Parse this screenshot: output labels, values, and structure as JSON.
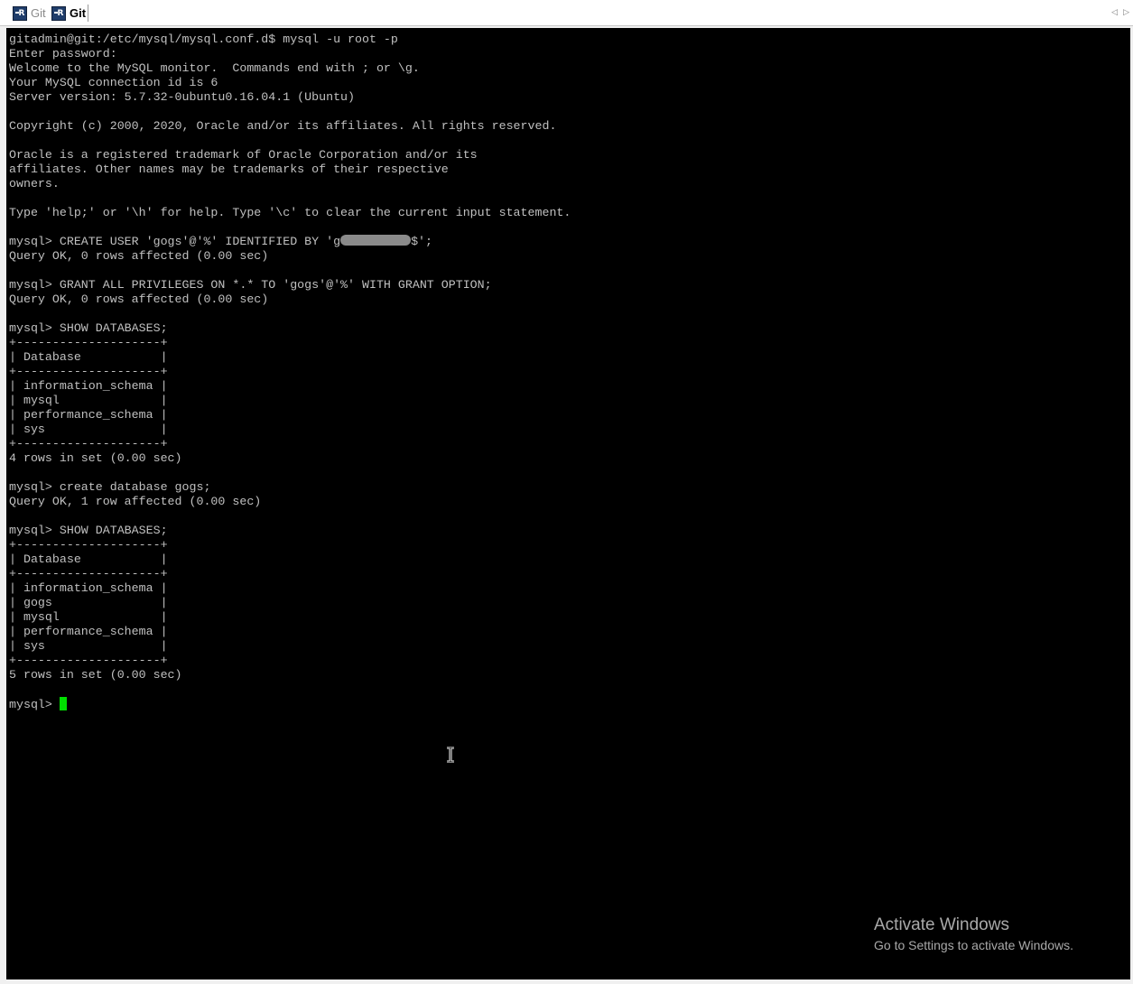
{
  "tabs": [
    {
      "label": "Git",
      "active": false,
      "icon": "putty-terminal-icon"
    },
    {
      "label": "Git",
      "active": true,
      "icon": "putty-terminal-icon"
    }
  ],
  "tab_icon_text": "R",
  "nav": {
    "prev": "◁",
    "next": "▷"
  },
  "terminal": {
    "lines": [
      "gitadmin@git:/etc/mysql/mysql.conf.d$ mysql -u root -p",
      "Enter password:",
      "Welcome to the MySQL monitor.  Commands end with ; or \\g.",
      "Your MySQL connection id is 6",
      "Server version: 5.7.32-0ubuntu0.16.04.1 (Ubuntu)",
      "",
      "Copyright (c) 2000, 2020, Oracle and/or its affiliates. All rights reserved.",
      "",
      "Oracle is a registered trademark of Oracle Corporation and/or its",
      "affiliates. Other names may be trademarks of their respective",
      "owners.",
      "",
      "Type 'help;' or '\\h' for help. Type '\\c' to clear the current input statement.",
      "",
      "",
      "Query OK, 0 rows affected (0.00 sec)",
      "",
      "mysql> GRANT ALL PRIVILEGES ON *.* TO 'gogs'@'%' WITH GRANT OPTION;",
      "Query OK, 0 rows affected (0.00 sec)",
      "",
      "mysql> SHOW DATABASES;",
      "+--------------------+",
      "| Database           |",
      "+--------------------+",
      "| information_schema |",
      "| mysql              |",
      "| performance_schema |",
      "| sys                |",
      "+--------------------+",
      "4 rows in set (0.00 sec)",
      "",
      "mysql> create database gogs;",
      "Query OK, 1 row affected (0.00 sec)",
      "",
      "mysql> SHOW DATABASES;",
      "+--------------------+",
      "| Database           |",
      "+--------------------+",
      "| information_schema |",
      "| gogs               |",
      "| mysql              |",
      "| performance_schema |",
      "| sys                |",
      "+--------------------+",
      "5 rows in set (0.00 sec)",
      "",
      ""
    ],
    "masked_line": {
      "before": "mysql> CREATE USER 'gogs'@'%' IDENTIFIED BY 'g",
      "after": "$';"
    },
    "prompt": "mysql> ",
    "text_color": "#c0c0c0",
    "background_color": "#000000",
    "cursor_color": "#00e000"
  },
  "watermark": {
    "title": "Activate Windows",
    "subtitle": "Go to Settings to activate Windows."
  }
}
